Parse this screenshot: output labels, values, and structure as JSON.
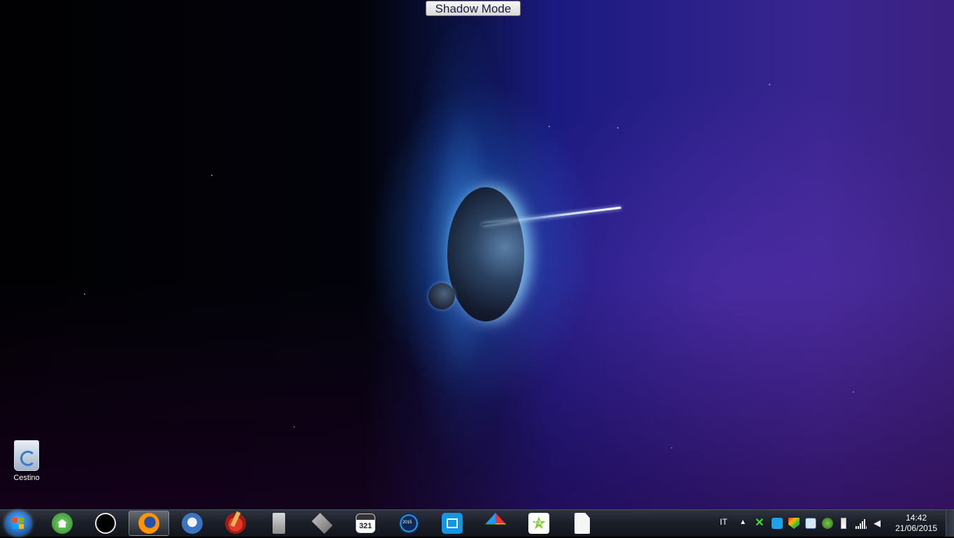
{
  "top_button": {
    "label": "Shadow Mode"
  },
  "desktop_icons": [
    {
      "label": "Cestino",
      "icon": "recycle-bin-icon"
    }
  ],
  "taskbar": {
    "start": {
      "icon": "windows-start-orb-icon"
    },
    "pinned_apps": [
      {
        "name": "home-app",
        "icon": "home-icon"
      },
      {
        "name": "circle-app",
        "icon": "circle-icon"
      },
      {
        "name": "firefox",
        "icon": "firefox-icon",
        "active": true
      },
      {
        "name": "thunderbird",
        "icon": "thunderbird-icon"
      },
      {
        "name": "ccleaner",
        "icon": "ccleaner-icon"
      },
      {
        "name": "server-app",
        "icon": "server-icon"
      },
      {
        "name": "tools-app",
        "icon": "tools-icon"
      },
      {
        "name": "123-app",
        "icon": "calendar-321-icon",
        "text": "321"
      },
      {
        "name": "2015-app",
        "icon": "2015-icon",
        "text": "2015"
      },
      {
        "name": "blue-app",
        "icon": "blue-square-icon"
      },
      {
        "name": "umbrella-app",
        "icon": "umbrella-icon"
      },
      {
        "name": "fx-app",
        "icon": "fx-star-icon",
        "text": "FX"
      },
      {
        "name": "document-app",
        "icon": "document-icon"
      }
    ]
  },
  "tray": {
    "language": "IT",
    "icons": [
      "show-hidden-icon",
      "x-icon",
      "shield-blue-icon",
      "shield-color-icon",
      "network-app-icon",
      "bug-icon",
      "battery-icon",
      "signal-icon",
      "volume-icon"
    ],
    "time": "14:42",
    "date": "21/06/2015"
  }
}
